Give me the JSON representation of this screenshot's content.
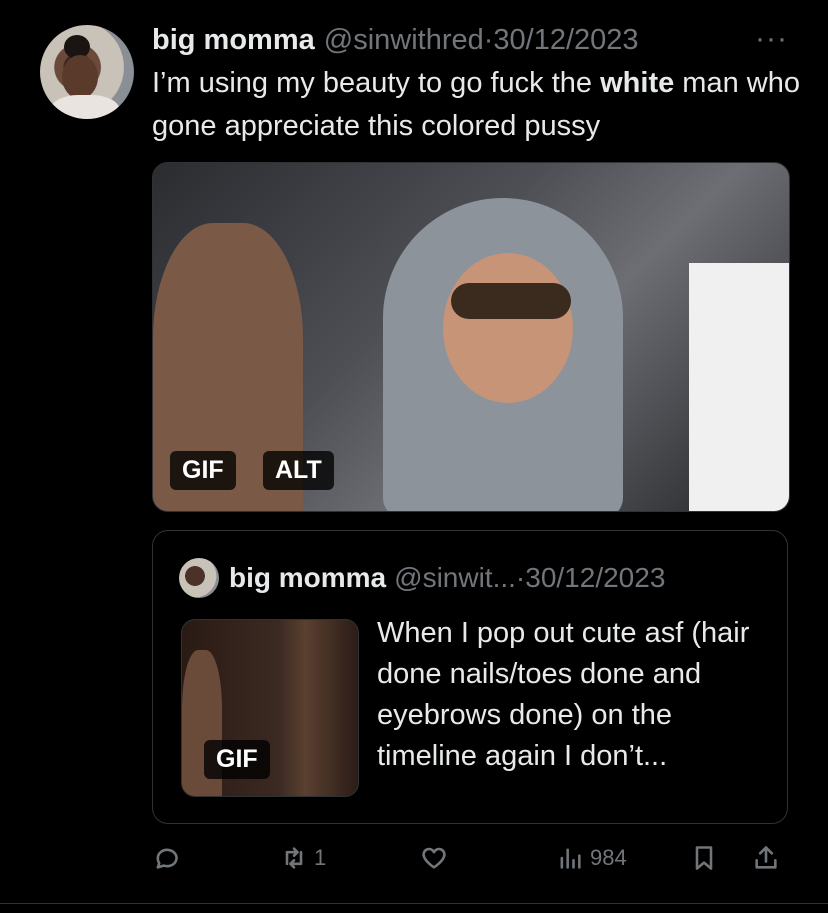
{
  "tweet": {
    "display_name": "big momma",
    "handle": "@sinwithred",
    "separator": " · ",
    "date": "30/12/2023",
    "more_icon": "···",
    "text_before": "I’m using my beauty to go fuck the ",
    "text_bold": "white",
    "text_after": " man who gone appreciate this colored pussy",
    "media": {
      "gif_badge": "GIF",
      "alt_badge": "ALT"
    }
  },
  "quote": {
    "display_name": "big momma",
    "handle": "@sinwit...",
    "separator": " · ",
    "date": "30/12/2023",
    "text": "When I pop out cute asf (hair done nails/toes done and eyebrows done) on the timeline again I don’t...",
    "gif_badge": "GIF"
  },
  "actions": {
    "reply_icon": "reply-icon",
    "retweet_icon": "retweet-icon",
    "retweet_count": "1",
    "like_icon": "heart-icon",
    "views_icon": "views-icon",
    "views_count": "984",
    "bookmark_icon": "bookmark-icon",
    "share_icon": "share-icon"
  },
  "colors": {
    "background": "#000000",
    "text": "#e7e9ea",
    "muted": "#71767b",
    "border": "#2f3336"
  }
}
